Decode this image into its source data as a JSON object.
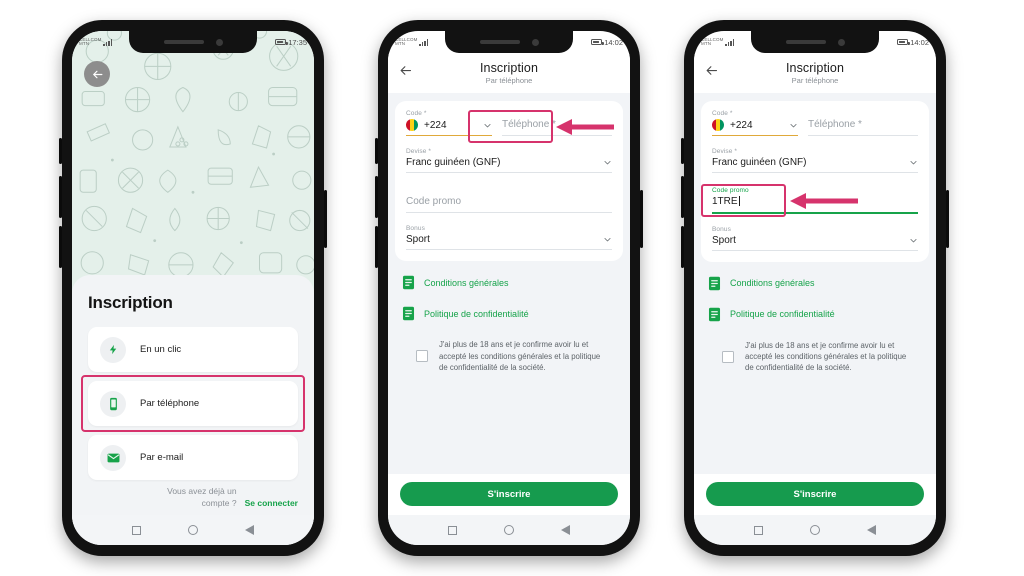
{
  "accent": {
    "green": "#16a34a",
    "pink": "#d6336c",
    "hero_bg": "#e4f0ea"
  },
  "phones": [
    {
      "id": "phone-1",
      "status": {
        "carrier_line1": "CELLCOM",
        "carrier_line2": "MTN",
        "time": "17:35"
      },
      "back_icon": "arrow-left-icon",
      "title": "Inscription",
      "options": [
        {
          "icon": "lightning-icon",
          "label": "En un clic",
          "highlighted": false
        },
        {
          "icon": "phone-icon",
          "label": "Par téléphone",
          "highlighted": true
        },
        {
          "icon": "envelope-icon",
          "label": "Par e-mail",
          "highlighted": false
        }
      ],
      "footer": {
        "question": "Vous avez déjà un compte ?",
        "link": "Se connecter"
      },
      "nav": {
        "recents": "square-icon",
        "home": "circle-icon",
        "back": "triangle-back-icon"
      }
    },
    {
      "id": "phone-2",
      "status": {
        "carrier_line1": "CELLCOM",
        "carrier_line2": "MTN",
        "time": "14:02"
      },
      "appbar": {
        "back_icon": "arrow-left-icon",
        "title": "Inscription",
        "subtitle": "Par téléphone"
      },
      "fields": {
        "code": {
          "label": "Code *",
          "value": "+224",
          "flag": "guinea-flag-icon",
          "chevron": "chevron-down-icon"
        },
        "phone": {
          "label": "",
          "placeholder": "Téléphone *",
          "value": "",
          "focused": false
        },
        "currency": {
          "label": "Devise *",
          "value": "Franc guinéen (GNF)",
          "chevron": "chevron-down-icon"
        },
        "promo": {
          "label": "",
          "placeholder": "Code promo",
          "value": "",
          "focused": false
        },
        "bonus": {
          "label": "Bonus",
          "value": "Sport",
          "chevron": "chevron-down-icon"
        }
      },
      "links": [
        {
          "icon": "document-icon",
          "label": "Conditions générales"
        },
        {
          "icon": "document-icon",
          "label": "Politique de confidentialité"
        }
      ],
      "consent": "J'ai plus de 18 ans et je confirme avoir lu et accepté les conditions générales et la politique de confidentialité de la société.",
      "submit": "S'inscrire",
      "annotation": {
        "target": "phone-field",
        "arrow": "arrow-left-annotation"
      }
    },
    {
      "id": "phone-3",
      "status": {
        "carrier_line1": "CELLCOM",
        "carrier_line2": "MTN",
        "time": "14:02"
      },
      "appbar": {
        "back_icon": "arrow-left-icon",
        "title": "Inscription",
        "subtitle": "Par téléphone"
      },
      "fields": {
        "code": {
          "label": "Code *",
          "value": "+224",
          "flag": "guinea-flag-icon",
          "chevron": "chevron-down-icon"
        },
        "phone": {
          "label": "",
          "placeholder": "Téléphone *",
          "value": "",
          "focused": false
        },
        "currency": {
          "label": "Devise *",
          "value": "Franc guinéen (GNF)",
          "chevron": "chevron-down-icon"
        },
        "promo": {
          "label": "Code promo",
          "placeholder": "Code promo",
          "value": "1TRE",
          "focused": true
        },
        "bonus": {
          "label": "Bonus",
          "value": "Sport",
          "chevron": "chevron-down-icon"
        }
      },
      "links": [
        {
          "icon": "document-icon",
          "label": "Conditions générales"
        },
        {
          "icon": "document-icon",
          "label": "Politique de confidentialité"
        }
      ],
      "consent": "J'ai plus de 18 ans et je confirme avoir lu et accepté les conditions générales et la politique de confidentialité de la société.",
      "submit": "S'inscrire",
      "annotation": {
        "target": "promo-field",
        "arrow": "arrow-left-annotation"
      }
    }
  ]
}
